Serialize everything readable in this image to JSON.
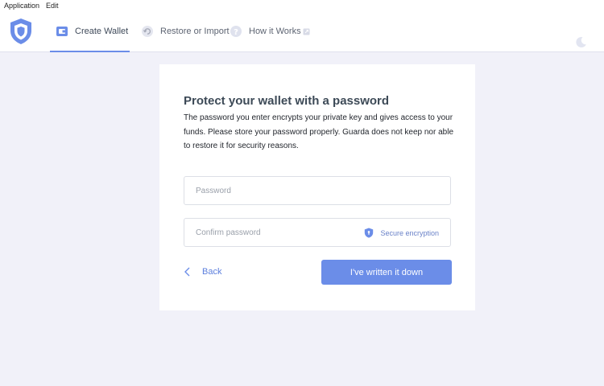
{
  "menubar": {
    "items": [
      "Application",
      "Edit"
    ]
  },
  "nav": {
    "create_wallet": "Create Wallet",
    "restore_import": "Restore or Import",
    "how_it_works": "How it Works"
  },
  "card": {
    "title": "Protect your wallet with a password",
    "description": "The password you enter encrypts your private key and gives access to your funds. Please store your password properly. Guarda does not keep nor able to restore it for security reasons.",
    "password_placeholder": "Password",
    "confirm_placeholder": "Confirm password",
    "secure_label": "Secure encryption",
    "back_label": "Back",
    "submit_label": "I've written it down"
  },
  "colors": {
    "accent": "#6b8de8",
    "background": "#f1f1f9",
    "title": "#3d4a57"
  },
  "icons": {
    "logo": "shield-logo-icon",
    "create_wallet": "wallet-icon",
    "restore": "restore-icon",
    "how": "help-icon",
    "external": "external-link-icon",
    "theme": "moon-icon",
    "secure": "shield-icon",
    "back": "chevron-left-icon"
  }
}
